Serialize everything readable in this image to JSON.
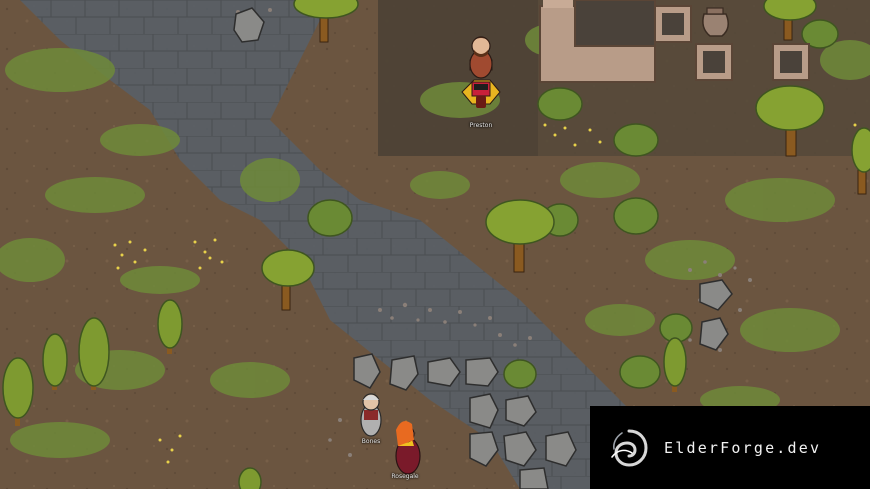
{
  "game": {
    "pawns": [
      {
        "name": "Preston"
      },
      {
        "name": "Bones"
      },
      {
        "name": "Rosegale"
      }
    ]
  },
  "watermark": {
    "text": "ElderForge.dev",
    "logo": "swirl-logo-icon"
  },
  "colors": {
    "ground": "#6b5540",
    "stone_path": "#585f64",
    "grass": "#6f8a3a",
    "foliage": "#86a232",
    "trunk": "#8a5a20",
    "wall": "#b89c88",
    "floor": "#4a423a",
    "watermark_bg": "#000000"
  }
}
